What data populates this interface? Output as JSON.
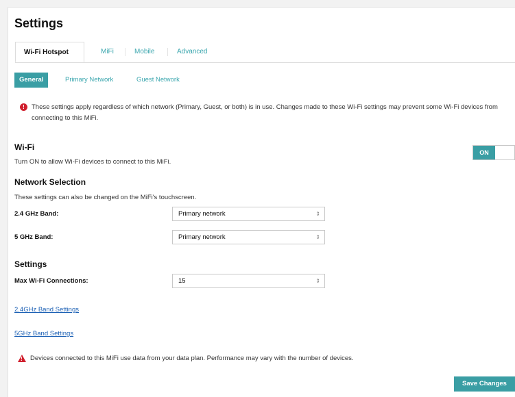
{
  "page_title": "Settings",
  "tabs": [
    {
      "label": "Wi-Fi Hotspot",
      "active": true
    },
    {
      "label": "MiFi",
      "active": false
    },
    {
      "label": "Mobile",
      "active": false
    },
    {
      "label": "Advanced",
      "active": false
    }
  ],
  "subtabs": [
    {
      "label": "General",
      "active": true
    },
    {
      "label": "Primary Network",
      "active": false
    },
    {
      "label": "Guest Network",
      "active": false
    }
  ],
  "info_notice": "These settings apply regardless of which network (Primary, Guest, or both) is in use. Changes made to these Wi-Fi settings may prevent some Wi-Fi devices from connecting to this MiFi.",
  "wifi": {
    "heading": "Wi-Fi",
    "description": "Turn ON to allow Wi-Fi devices to connect to this MiFi.",
    "toggle_label": "ON"
  },
  "network_selection": {
    "heading": "Network Selection",
    "description": "These settings can also be changed on the MiFi's touchscreen.",
    "band_24_label": "2.4 GHz Band:",
    "band_24_value": "Primary network",
    "band_5_label": "5 GHz Band:",
    "band_5_value": "Primary network"
  },
  "settings": {
    "heading": "Settings",
    "max_connections_label": "Max Wi-Fi Connections:",
    "max_connections_value": "15"
  },
  "links": {
    "band_24": "2.4GHz Band Settings",
    "band_5": "5GHz Band Settings"
  },
  "warning": "Devices connected to this MiFi use data from your data plan. Performance may vary with the number of devices.",
  "save_label": "Save Changes",
  "colors": {
    "accent": "#3a9ea4",
    "link": "#1a5fb4",
    "alert": "#d0202e"
  }
}
